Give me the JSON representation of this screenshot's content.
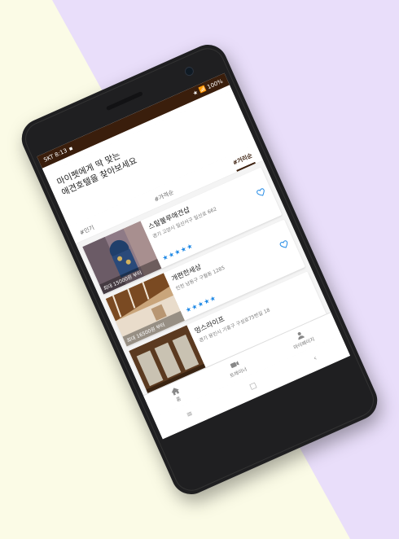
{
  "colors": {
    "lavender": "#e9defa",
    "cream": "#fbfbe6",
    "status_bar": "#3a1e0c",
    "star_blue": "#1e88e5"
  },
  "status_bar": {
    "carrier_time": "SKT 8:13",
    "indicators": "★ 📶 100%"
  },
  "header": {
    "title": "마이펫에게 딱 맞는\n애견호텔을 찾아보세요"
  },
  "filters": [
    {
      "label": "#인기",
      "active": false
    },
    {
      "label": "#가격순",
      "active": false
    },
    {
      "label": "#거리순",
      "active": true
    }
  ],
  "hotels": [
    {
      "name": "스탈불루애견샵",
      "address": "경기 고양시 일산서구 일산로 662",
      "price": "최대 15000원 부터",
      "stars": "★★★★★"
    },
    {
      "name": "개편한세상",
      "address": "인천 남동구 구월동 1285",
      "price": "최대 16500원 부터",
      "stars": "★★★★★"
    },
    {
      "name": "멍스라이프",
      "address": "경기 용인시 기흥구 구성로75번길 18",
      "price": "",
      "stars": ""
    }
  ],
  "tabbar": [
    {
      "label": "홈",
      "icon": "home-icon"
    },
    {
      "label": "트레이너",
      "icon": "video-icon"
    },
    {
      "label": "마이페이지",
      "icon": "person-icon"
    }
  ],
  "navbar": {
    "menu": "≡",
    "home": "□",
    "back": "‹"
  }
}
